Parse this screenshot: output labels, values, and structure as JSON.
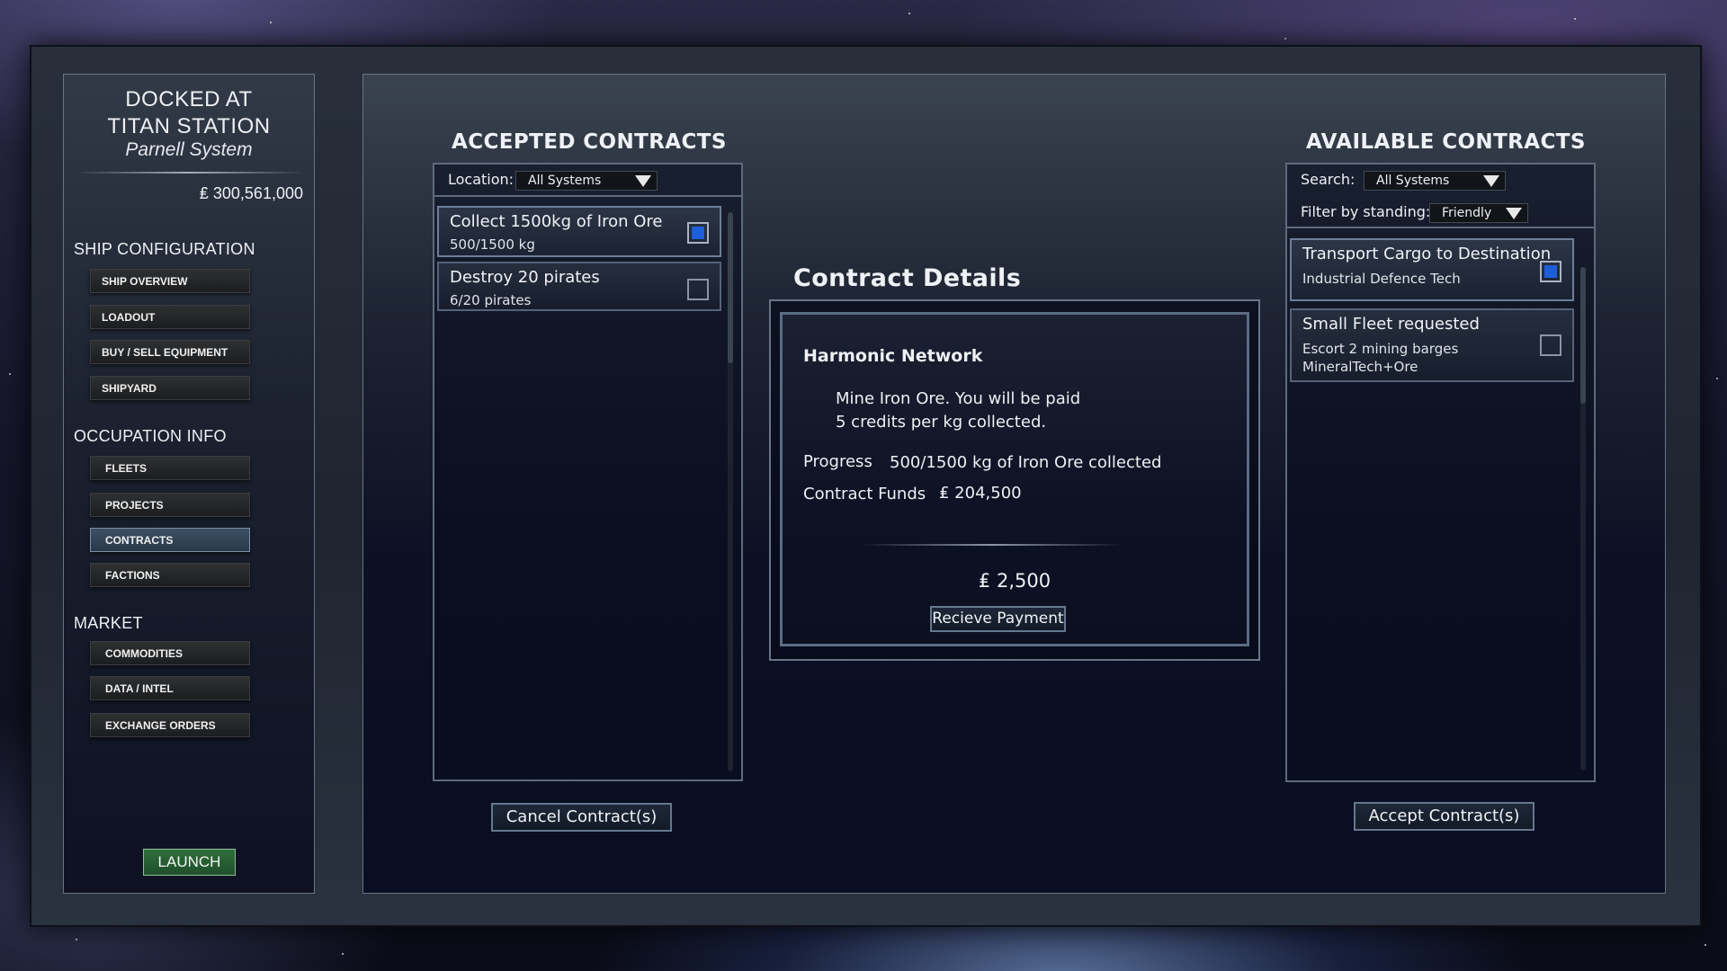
{
  "station": {
    "docked_line1": "DOCKED AT",
    "docked_line2": "TITAN STATION",
    "system": "Parnell System",
    "credits": "₤ 300,561,000"
  },
  "sidebar": {
    "ship_config": {
      "heading": "SHIP CONFIGURATION",
      "items": [
        "SHIP OVERVIEW",
        "LOADOUT",
        "BUY /  SELL EQUIPMENT",
        "SHIPYARD"
      ]
    },
    "occupation": {
      "heading": "OCCUPATION INFO",
      "items": [
        "FLEETS",
        "PROJECTS",
        "CONTRACTS",
        "FACTIONS"
      ],
      "active": "CONTRACTS"
    },
    "market": {
      "heading": "MARKET",
      "items": [
        "COMMODITIES",
        "DATA / INTEL",
        "EXCHANGE ORDERS"
      ]
    },
    "launch_label": "LAUNCH"
  },
  "accepted": {
    "title": "ACCEPTED CONTRACTS",
    "location_label": "Location:",
    "location_value": "All Systems",
    "items": [
      {
        "title": "Collect 1500kg of Iron Ore",
        "sub": "500/1500 kg",
        "checked": true
      },
      {
        "title": "Destroy 20 pirates",
        "sub": "6/20 pirates",
        "checked": false
      }
    ],
    "cancel_label": "Cancel Contract(s)"
  },
  "details": {
    "title": "Contract Details",
    "issuer": "Harmonic Network",
    "desc_line1": "Mine Iron Ore. You will be paid",
    "desc_line2": "5 credits per kg collected.",
    "progress_label": "Progress",
    "progress_value": "500/1500 kg of Iron Ore collected",
    "funds_label": "Contract Funds",
    "funds_value": "₤ 204,500",
    "payment_amount": "₤ 2,500",
    "payment_button": "Recieve Payment"
  },
  "available": {
    "title": "AVAILABLE CONTRACTS",
    "search_label": "Search:",
    "search_value": "All Systems",
    "standing_label": "Filter by standing:",
    "standing_value": "Friendly",
    "items": [
      {
        "title": "Transport Cargo to Destination",
        "sub1": "Industrial Defence Tech",
        "checked": true
      },
      {
        "title": "Small Fleet requested",
        "sub1": "Escort 2 mining barges",
        "sub2": "MineralTech+Ore",
        "checked": false
      }
    ],
    "accept_label": "Accept Contract(s)"
  },
  "colors": {
    "checkbox_fill": "#1e5ed8",
    "launch_green": "#2f6e3c",
    "active_nav": "#3e5064"
  }
}
